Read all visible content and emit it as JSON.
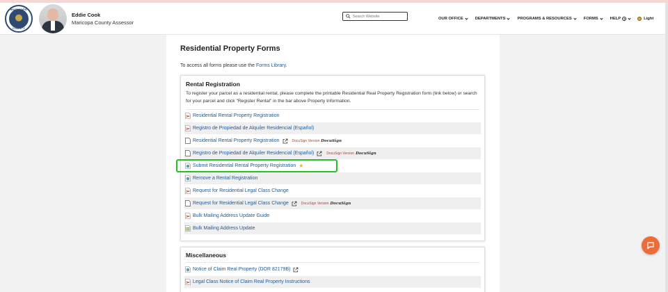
{
  "header": {
    "seal_text_top": "MARICOPA",
    "seal_text_bottom": "COUNTY",
    "name": "Eddie Cook",
    "office": "Maricopa County Assessor",
    "search_placeholder": "Search Website",
    "nav": [
      {
        "label": "OUR OFFICE"
      },
      {
        "label": "DEPARTMENTS"
      },
      {
        "label": "PROGRAMS & RESOURCES"
      },
      {
        "label": "FORMS"
      },
      {
        "label": "HELP"
      }
    ],
    "theme_label": "Light"
  },
  "page": {
    "title": "Residential Property Forms",
    "intro_prefix": "To access all forms please use the ",
    "intro_link": "Forms Library",
    "intro_suffix": "."
  },
  "rental": {
    "title": "Rental Registration",
    "description": "To register your parcel as a residential rental, please complete the printable Residential Real Property Registration form (link below) or search for your parcel and click \"Register Rental\" in the bar above Property Information.",
    "items": [
      {
        "label": "Residential Rental Property Registration",
        "icon": "pdf-icon"
      },
      {
        "label": "Registro de Propiedad de Alquiler Residencial (Español)",
        "icon": "pdf-icon"
      },
      {
        "label": "Residential Rental Property Registration",
        "icon": "document-icon",
        "docusign": "DocuSign Version",
        "docusign_logo": "DocuSign"
      },
      {
        "label": "Registro de Propiedad de Alquiler Residencial (Español)",
        "icon": "document-icon",
        "docusign": "DocuSign Version",
        "docusign_logo": "DocuSign"
      },
      {
        "label": "Submit Residential Rental Property Registration",
        "icon": "online-form-icon",
        "star": true
      },
      {
        "label": "Remove a Rental Registration",
        "icon": "online-form-icon"
      },
      {
        "label": "Request for Residential Legal Class Change",
        "icon": "pdf-icon"
      },
      {
        "label": "Request for Residential Legal Class Change",
        "icon": "document-icon",
        "docusign": "DocuSign Version",
        "docusign_logo": "DocuSign"
      },
      {
        "label": "Bulk Mailing Address Update Guide",
        "icon": "pdf-icon"
      },
      {
        "label": "Bulk Mailing Address Update",
        "icon": "spreadsheet-icon"
      }
    ]
  },
  "misc": {
    "title": "Miscellaneous",
    "items": [
      {
        "label": "Notice of Claim Real Property (DOR 82179B)",
        "icon": "online-form-icon"
      },
      {
        "label": "Legal Class Notice of Claim Real Property Instructions",
        "icon": "pdf-icon"
      }
    ]
  },
  "colors": {
    "accent": "#1f5a94",
    "highlight": "#26c026",
    "chat": "#ec6d37"
  }
}
